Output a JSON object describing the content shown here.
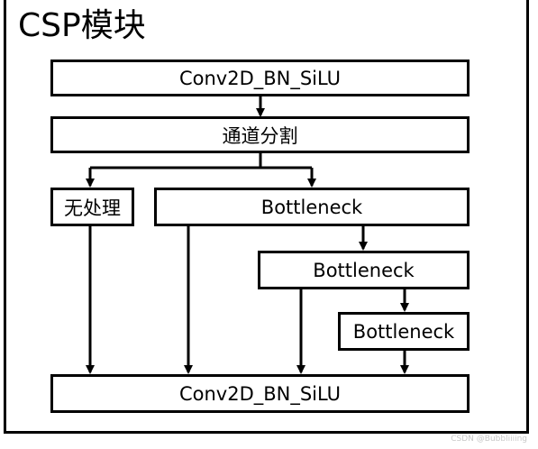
{
  "title": "CSP模块",
  "nodes": {
    "conv_top": "Conv2D_BN_SiLU",
    "split": "通道分割",
    "passthrough": "无处理",
    "bottleneck_1": "Bottleneck",
    "bottleneck_2": "Bottleneck",
    "bottleneck_3": "Bottleneck",
    "conv_bottom": "Conv2D_BN_SiLU"
  },
  "edges": [
    {
      "from": "conv_top",
      "to": "split"
    },
    {
      "from": "split",
      "to": "passthrough"
    },
    {
      "from": "split",
      "to": "bottleneck_1"
    },
    {
      "from": "bottleneck_1",
      "to": "bottleneck_2"
    },
    {
      "from": "bottleneck_2",
      "to": "bottleneck_3"
    },
    {
      "from": "passthrough",
      "to": "conv_bottom"
    },
    {
      "from": "bottleneck_1",
      "to": "conv_bottom"
    },
    {
      "from": "bottleneck_2",
      "to": "conv_bottom"
    },
    {
      "from": "bottleneck_3",
      "to": "conv_bottom"
    }
  ],
  "watermark": "CSDN @Bubbliiiing"
}
